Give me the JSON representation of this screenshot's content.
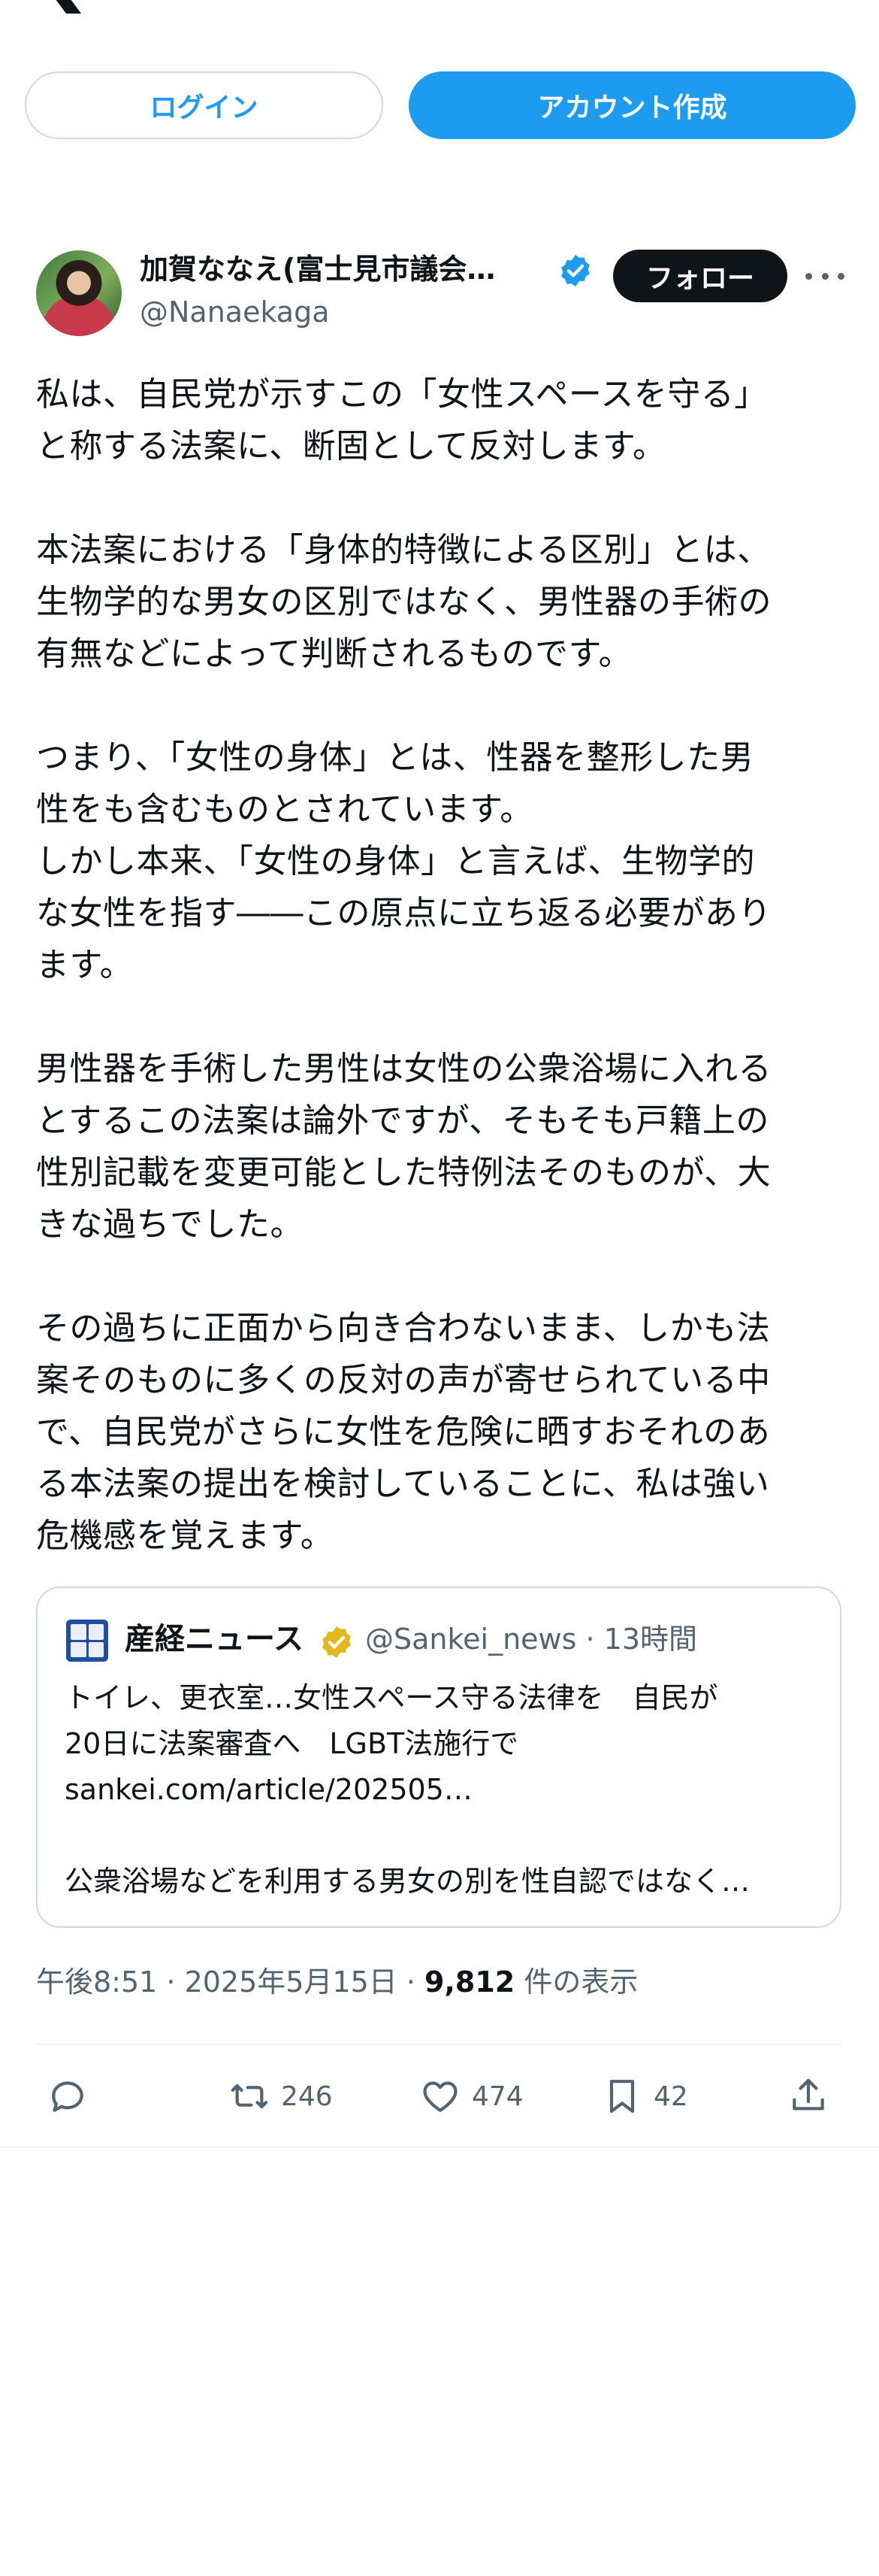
{
  "header": {
    "login_label": "ログイン",
    "signup_label": "アカウント作成"
  },
  "author": {
    "name": "加賀ななえ(富士見市議会…",
    "handle": "@Nanaekaga",
    "follow_label": "フォロー",
    "verified": true
  },
  "tweet": {
    "text": "私は、自民党が示すこの「女性スペースを守る」\nと称する法案に、断固として反対します。\n\n本法案における「身体的特徴による区別」とは、\n生物学的な男女の区別ではなく、男性器の手術の\n有無などによって判断されるものです。\n\nつまり、「女性の身体」とは、性器を整形した男\n性をも含むものとされています。\nしかし本来、「女性の身体」と言えば、生物学的\nな女性を指す――この原点に立ち返る必要があり\nます。\n\n男性器を手術した男性は女性の公衆浴場に入れる\nとするこの法案は論外ですが、そもそも戸籍上の\n性別記載を変更可能とした特例法そのものが、大\nきな過ちでした。\n\nその過ちに正面から向き合わないまま、しかも法\n案そのものに多くの反対の声が寄せられている中\nで、自民党がさらに女性を危険に晒すおそれのあ\nる本法案の提出を検討していることに、私は強い\n危機感を覚えます。"
  },
  "quote": {
    "name": "産経ニュース",
    "handle": "@Sankei_news · 13時間",
    "text": "トイレ、更衣室…女性スペース守る法律を　自民が\n20日に法案審査へ　LGBT法施行で\nsankei.com/article/202505…",
    "summary": "公衆浴場などを利用する男女の別を性自認ではなく…"
  },
  "meta": {
    "time": "午後8:51 · 2025年5月15日 · ",
    "views": "9,812",
    "views_suffix": " 件の表示"
  },
  "actions": {
    "retweets": "246",
    "likes": "474",
    "bookmarks": "42"
  },
  "colors": {
    "accent": "#1d9bf0",
    "text": "#0f1419",
    "secondary": "#536471",
    "border": "#cfd9de",
    "gold_badge": "#e2b719"
  }
}
